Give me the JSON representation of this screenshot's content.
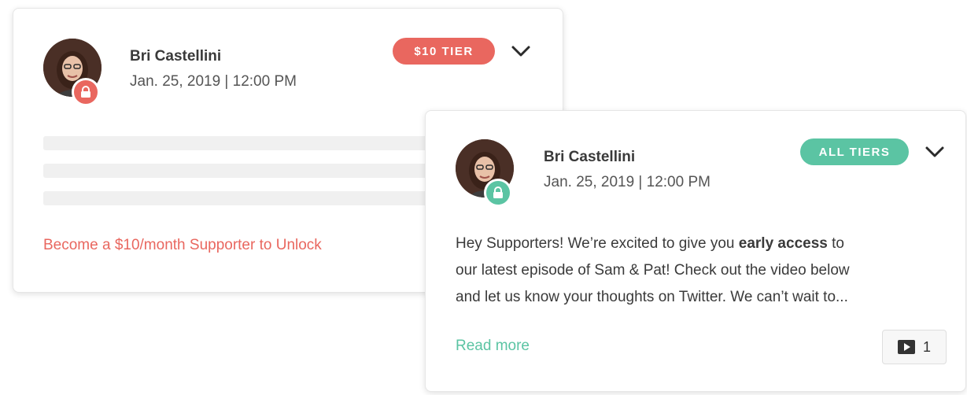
{
  "colors": {
    "locked_accent": "#e9675f",
    "unlocked_accent": "#5bc4a3",
    "text_dark": "#3a3a3a",
    "text_muted": "#555555",
    "placeholder": "#f0f0f0"
  },
  "locked_post": {
    "author": "Bri Castellini",
    "date": "Jan. 25, 2019 | 12:00 PM",
    "tier_label": "$10 TIER",
    "lock_icon": "lock-icon",
    "menu_icon": "chevron-down-icon",
    "unlock_cta": "Become a $10/month Supporter to Unlock"
  },
  "unlocked_post": {
    "author": "Bri Castellini",
    "date": "Jan. 25, 2019 | 12:00 PM",
    "tier_label": "ALL TIERS",
    "lock_icon": "unlocked-lock-icon",
    "menu_icon": "chevron-down-icon",
    "body": {
      "line1_pre": "Hey Supporters! We’re excited to give you ",
      "line1_bold": "early access",
      "line1_post": " to",
      "line2": "our latest episode of Sam & Pat! Check out the video below",
      "line3": "and let us know your thoughts on Twitter. We can’t wait to..."
    },
    "read_more": "Read more",
    "media_icon": "video-icon",
    "media_count": "1"
  }
}
